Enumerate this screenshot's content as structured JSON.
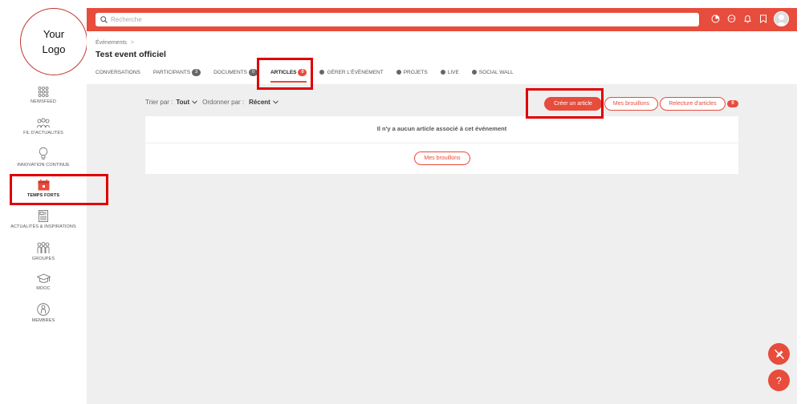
{
  "logo": {
    "line1": "Your",
    "line2": "Logo"
  },
  "sidebar": {
    "items": [
      {
        "label": "NEWSFEED"
      },
      {
        "label": "FIL D'ACTUALITÉS"
      },
      {
        "label": "INNOVATION CONTINUE"
      },
      {
        "label": "TEMPS FORTS"
      },
      {
        "label": "ACTUALITÉS & INSPIRATIONS"
      },
      {
        "label": "GROUPES"
      },
      {
        "label": "MOOC"
      },
      {
        "label": "MEMBRES"
      }
    ]
  },
  "search": {
    "placeholder": "Recherche"
  },
  "header": {
    "breadcrumb": "Événements",
    "breadcrumb_sep": ">",
    "title": "Test event officiel"
  },
  "tabs": [
    {
      "label": "CONVERSATIONS"
    },
    {
      "label": "PARTICIPANTS",
      "badge": "3"
    },
    {
      "label": "DOCUMENTS",
      "badge": "0"
    },
    {
      "label": "ARTICLES",
      "badge": "0"
    },
    {
      "label": "GÉRER L'ÉVÈNEMENT"
    },
    {
      "label": "PROJETS"
    },
    {
      "label": "LIVE"
    },
    {
      "label": "SOCIAL WALL"
    }
  ],
  "filters": {
    "sort_label": "Trier par :",
    "sort_value": "Tout",
    "order_label": "Ordonner par :",
    "order_value": "Récent"
  },
  "actions": {
    "create": "Créer un article",
    "drafts": "Mes brouillons",
    "review": "Relecture d'articles",
    "review_count": "0"
  },
  "empty": {
    "message": "Il n'y a aucun article associé à cet événement",
    "drafts_button": "Mes brouillons"
  },
  "colors": {
    "accent": "#e74c3c",
    "highlight": "#e00000"
  }
}
